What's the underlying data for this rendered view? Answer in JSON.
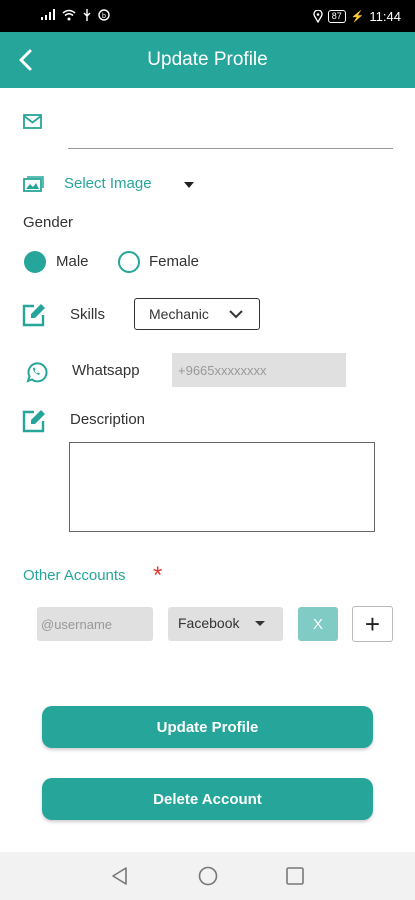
{
  "status_bar": {
    "time": "11:44",
    "battery": "87"
  },
  "app_bar": {
    "title": "Update Profile"
  },
  "email": {
    "value": ""
  },
  "image": {
    "select_label": "Select Image"
  },
  "gender": {
    "label": "Gender",
    "options": [
      {
        "label": "Male",
        "selected": true
      },
      {
        "label": "Female",
        "selected": false
      }
    ]
  },
  "skills": {
    "label": "Skills",
    "selected": "Mechanic"
  },
  "whatsapp": {
    "label": "Whatsapp",
    "placeholder": "+9665xxxxxxxx"
  },
  "description": {
    "label": "Description",
    "value": ""
  },
  "other_accounts": {
    "label": "Other Accounts",
    "required_mark": "*",
    "username_placeholder": "@username",
    "platform": "Facebook",
    "remove_label": "X",
    "add_label": "+"
  },
  "buttons": {
    "update": "Update Profile",
    "delete": "Delete Account"
  },
  "colors": {
    "primary": "#26a69a",
    "primary_light": "#80cbc4",
    "required": "#e53935"
  }
}
